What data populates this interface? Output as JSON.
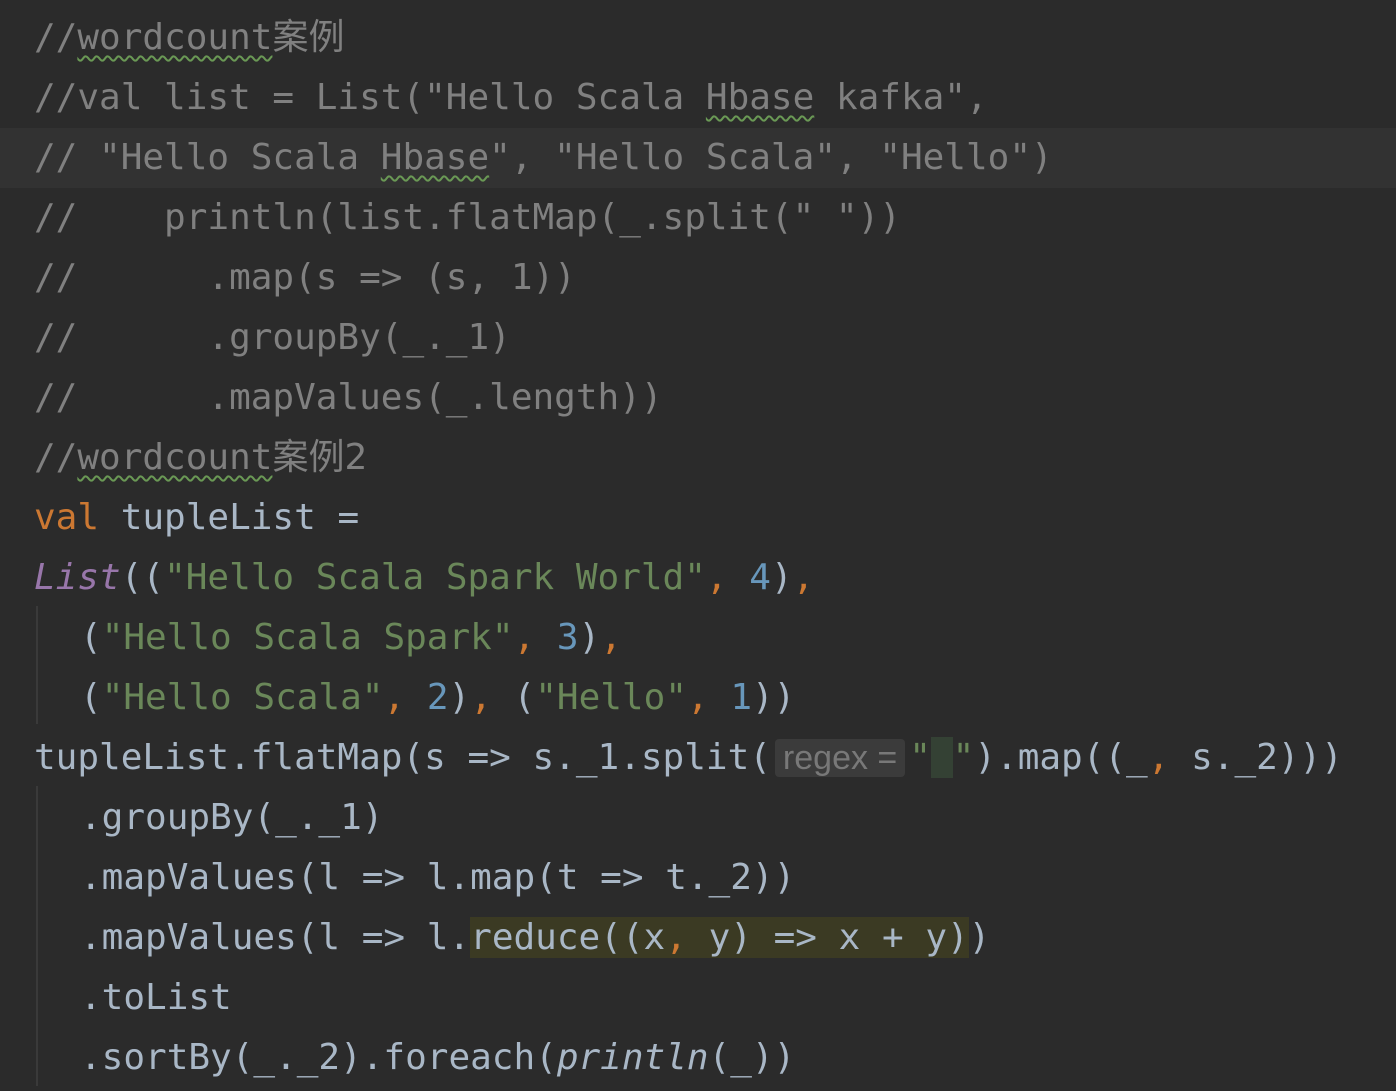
{
  "editor": {
    "lines": [
      {
        "parts": [
          {
            "t": "//",
            "c": "cm"
          },
          {
            "t": "wordcount",
            "c": "cm typo"
          },
          {
            "t": "案例",
            "c": "cm cjk"
          }
        ]
      },
      {
        "parts": [
          {
            "t": "//val list = List(\"Hello Scala ",
            "c": "cm"
          },
          {
            "t": "Hbase",
            "c": "cm typo"
          },
          {
            "t": " kafka\",",
            "c": "cm"
          }
        ]
      },
      {
        "parts": [
          {
            "t": "// \"Hello Scala ",
            "c": "cm"
          },
          {
            "t": "Hbase",
            "c": "cm typo"
          },
          {
            "t": "\", \"Hello Scala\", \"Hello\")",
            "c": "cm"
          }
        ]
      },
      {
        "parts": [
          {
            "t": "//    println(list.flatMap(_.split(\" \"))",
            "c": "cm"
          }
        ]
      },
      {
        "parts": [
          {
            "t": "//      .map(s => (s, 1))",
            "c": "cm"
          }
        ]
      },
      {
        "parts": [
          {
            "t": "//      .groupBy(_._1)",
            "c": "cm"
          }
        ]
      },
      {
        "parts": [
          {
            "t": "//      .mapValues(_.length))",
            "c": "cm"
          }
        ]
      },
      {
        "parts": [
          {
            "t": "//",
            "c": "cm"
          },
          {
            "t": "wordcount",
            "c": "cm typo"
          },
          {
            "t": "案例2",
            "c": "cm cjk"
          }
        ]
      },
      {
        "parts": [
          {
            "t": "val",
            "c": "kw"
          },
          {
            "t": " tupleList =",
            "c": ""
          }
        ]
      },
      {
        "parts": [
          {
            "t": "List",
            "c": "type"
          },
          {
            "t": "((",
            "c": ""
          },
          {
            "t": "\"Hello Scala Spark World\"",
            "c": "str"
          },
          {
            "t": ", ",
            "c": "kw"
          },
          {
            "t": "4",
            "c": "num"
          },
          {
            "t": ")",
            "c": ""
          },
          {
            "t": ",",
            "c": "kw"
          }
        ]
      },
      {
        "parts": [
          {
            "t": "(",
            "c": ""
          },
          {
            "t": "\"Hello Scala Spark\"",
            "c": "str"
          },
          {
            "t": ", ",
            "c": "kw"
          },
          {
            "t": "3",
            "c": "num"
          },
          {
            "t": ")",
            "c": ""
          },
          {
            "t": ",",
            "c": "kw"
          }
        ]
      },
      {
        "parts": [
          {
            "t": "(",
            "c": ""
          },
          {
            "t": "\"Hello Scala\"",
            "c": "str"
          },
          {
            "t": ", ",
            "c": "kw"
          },
          {
            "t": "2",
            "c": "num"
          },
          {
            "t": ")",
            "c": ""
          },
          {
            "t": ", ",
            "c": "kw"
          },
          {
            "t": "(",
            "c": ""
          },
          {
            "t": "\"Hello\"",
            "c": "str"
          },
          {
            "t": ", ",
            "c": "kw"
          },
          {
            "t": "1",
            "c": "num"
          },
          {
            "t": "))",
            "c": ""
          }
        ]
      },
      {
        "parts": [
          {
            "t": "tupleList.flatMap(s => s._1.split(",
            "c": ""
          },
          {
            "t": "regex =",
            "c": "hint"
          },
          {
            "t": "\"",
            "c": "str"
          },
          {
            "t": " ",
            "c": "str caret-bg"
          },
          {
            "t": "\"",
            "c": "str"
          },
          {
            "t": ").map((_",
            "c": ""
          },
          {
            "t": ", ",
            "c": "kw"
          },
          {
            "t": "s._2)))",
            "c": ""
          }
        ]
      },
      {
        "parts": [
          {
            "t": ".groupBy(_._1)",
            "c": ""
          }
        ]
      },
      {
        "parts": [
          {
            "t": ".mapValues(l => l.map(t => t._2))",
            "c": ""
          }
        ]
      },
      {
        "parts": [
          {
            "t": ".mapValues(l => l.",
            "c": ""
          },
          {
            "t": "reduce((x",
            "c": "hl"
          },
          {
            "t": ", ",
            "c": "hl kw"
          },
          {
            "t": "y) => x + y)",
            "c": "hl"
          },
          {
            "t": ")",
            "c": ""
          }
        ]
      },
      {
        "parts": [
          {
            "t": ".toList",
            "c": ""
          }
        ]
      },
      {
        "parts": [
          {
            "t": ".sortBy(_._2).foreach(",
            "c": ""
          },
          {
            "t": "println",
            "c": "it"
          },
          {
            "t": "(_))",
            "c": ""
          }
        ]
      }
    ]
  }
}
